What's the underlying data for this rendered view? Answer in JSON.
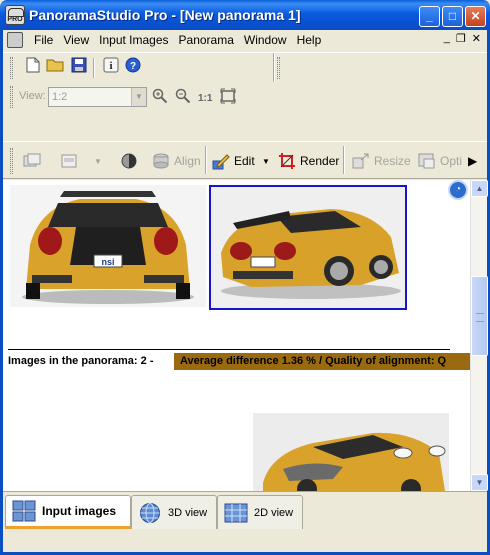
{
  "window": {
    "title": "PanoramaStudio Pro - [New panorama 1]",
    "min_glyph": "_",
    "max_glyph": "□",
    "close_glyph": "✕"
  },
  "menu": [
    "File",
    "View",
    "Input Images",
    "Panorama",
    "Window",
    "Help"
  ],
  "mdi": {
    "min": "_",
    "restore": "❐",
    "close": "✕"
  },
  "toolbar2": {
    "view_label": "View:",
    "zoom_value": "1:2"
  },
  "toolbar3": {
    "align_label": "Align",
    "edit_label": "Edit",
    "render_label": "Render",
    "resize_label": "Resize",
    "optimize_label": "Opti"
  },
  "content": {
    "images_label": "Images in the panorama: 2 -",
    "quality_badge": "Average difference 1.36 % / Quality of alignment: Q",
    "plate_text": "nsi"
  },
  "tabs": {
    "input_images": "Input images",
    "view_3d": "3D view",
    "view_2d": "2D view"
  },
  "colors": {
    "titlebar": "#0a5be0",
    "selection_border": "#1515d0",
    "quality_badge": "#9a6a10",
    "active_tab_underline": "#f0a030"
  }
}
